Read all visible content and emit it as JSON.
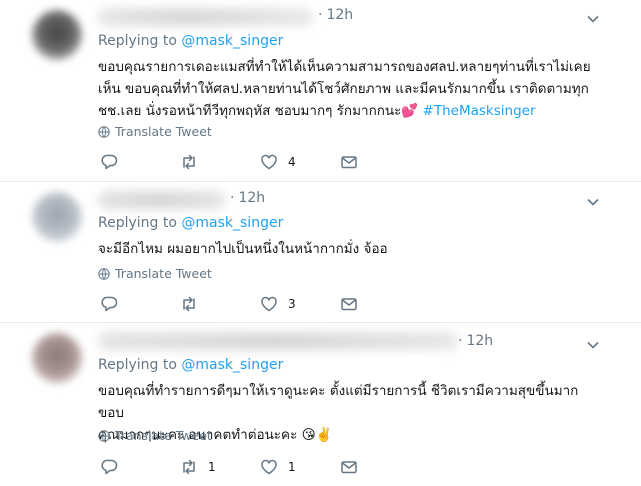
{
  "tweets": [
    {
      "time": "12h",
      "replying_prefix": "Replying to",
      "replying_handle": "@mask_singer",
      "text_lines": [
        "ขอบคุณรายการเดอะแมสที่ทำให้ได้เห็นความสามารถของศลป.หลายๆท่านที่เราไม่เคย",
        "เห็น ขอบคุณที่ทำให้ศลป.หลายท่านได้โชว์ศักยภาพ และมีคนรักมากขึ้น เราติดตามทุก",
        "ชช.เลย นั่งรอหน้าทีวีทุกพฤหัส ชอบมากๆ รักมากกนะ"
      ],
      "emoji": "💕",
      "hashtag": "#TheMasksinger",
      "translate_label": "Translate Tweet",
      "reply_count": "",
      "retweet_count": "",
      "like_count": "4"
    },
    {
      "time": "12h",
      "replying_prefix": "Replying to",
      "replying_handle": "@mask_singer",
      "text": "จะมีอีกไหม ผมอยากไปเป็นหนึ่งในหน้ากากมั่ง จ้ออ",
      "translate_label": "Translate Tweet",
      "reply_count": "",
      "retweet_count": "",
      "like_count": "3"
    },
    {
      "time": "12h",
      "replying_prefix": "Replying to",
      "replying_handle": "@mask_singer",
      "text_lines": [
        "ขอบคุณที่ทำรายการดีๆมาให้เราดูนะคะ ตั้งแต่มีรายการนี้ ชีวิตเรามีความสุขขึ้นมาก ขอบ",
        "คุณมากๆนะคะ อนาคตทำต่อนะคะ"
      ],
      "emoji": "😘✌️",
      "translate_label": "Translate Tweet",
      "reply_count": "",
      "retweet_count": "1",
      "like_count": "1"
    }
  ],
  "icons": {
    "reply": "reply-icon",
    "retweet": "retweet-icon",
    "like": "heart-icon",
    "dm": "envelope-icon",
    "translate": "globe-icon",
    "menu": "chevron-down-icon"
  },
  "colors": {
    "link": "#1da1f2",
    "muted": "#657786",
    "text": "#14171a",
    "divider": "#e6ecf0"
  }
}
